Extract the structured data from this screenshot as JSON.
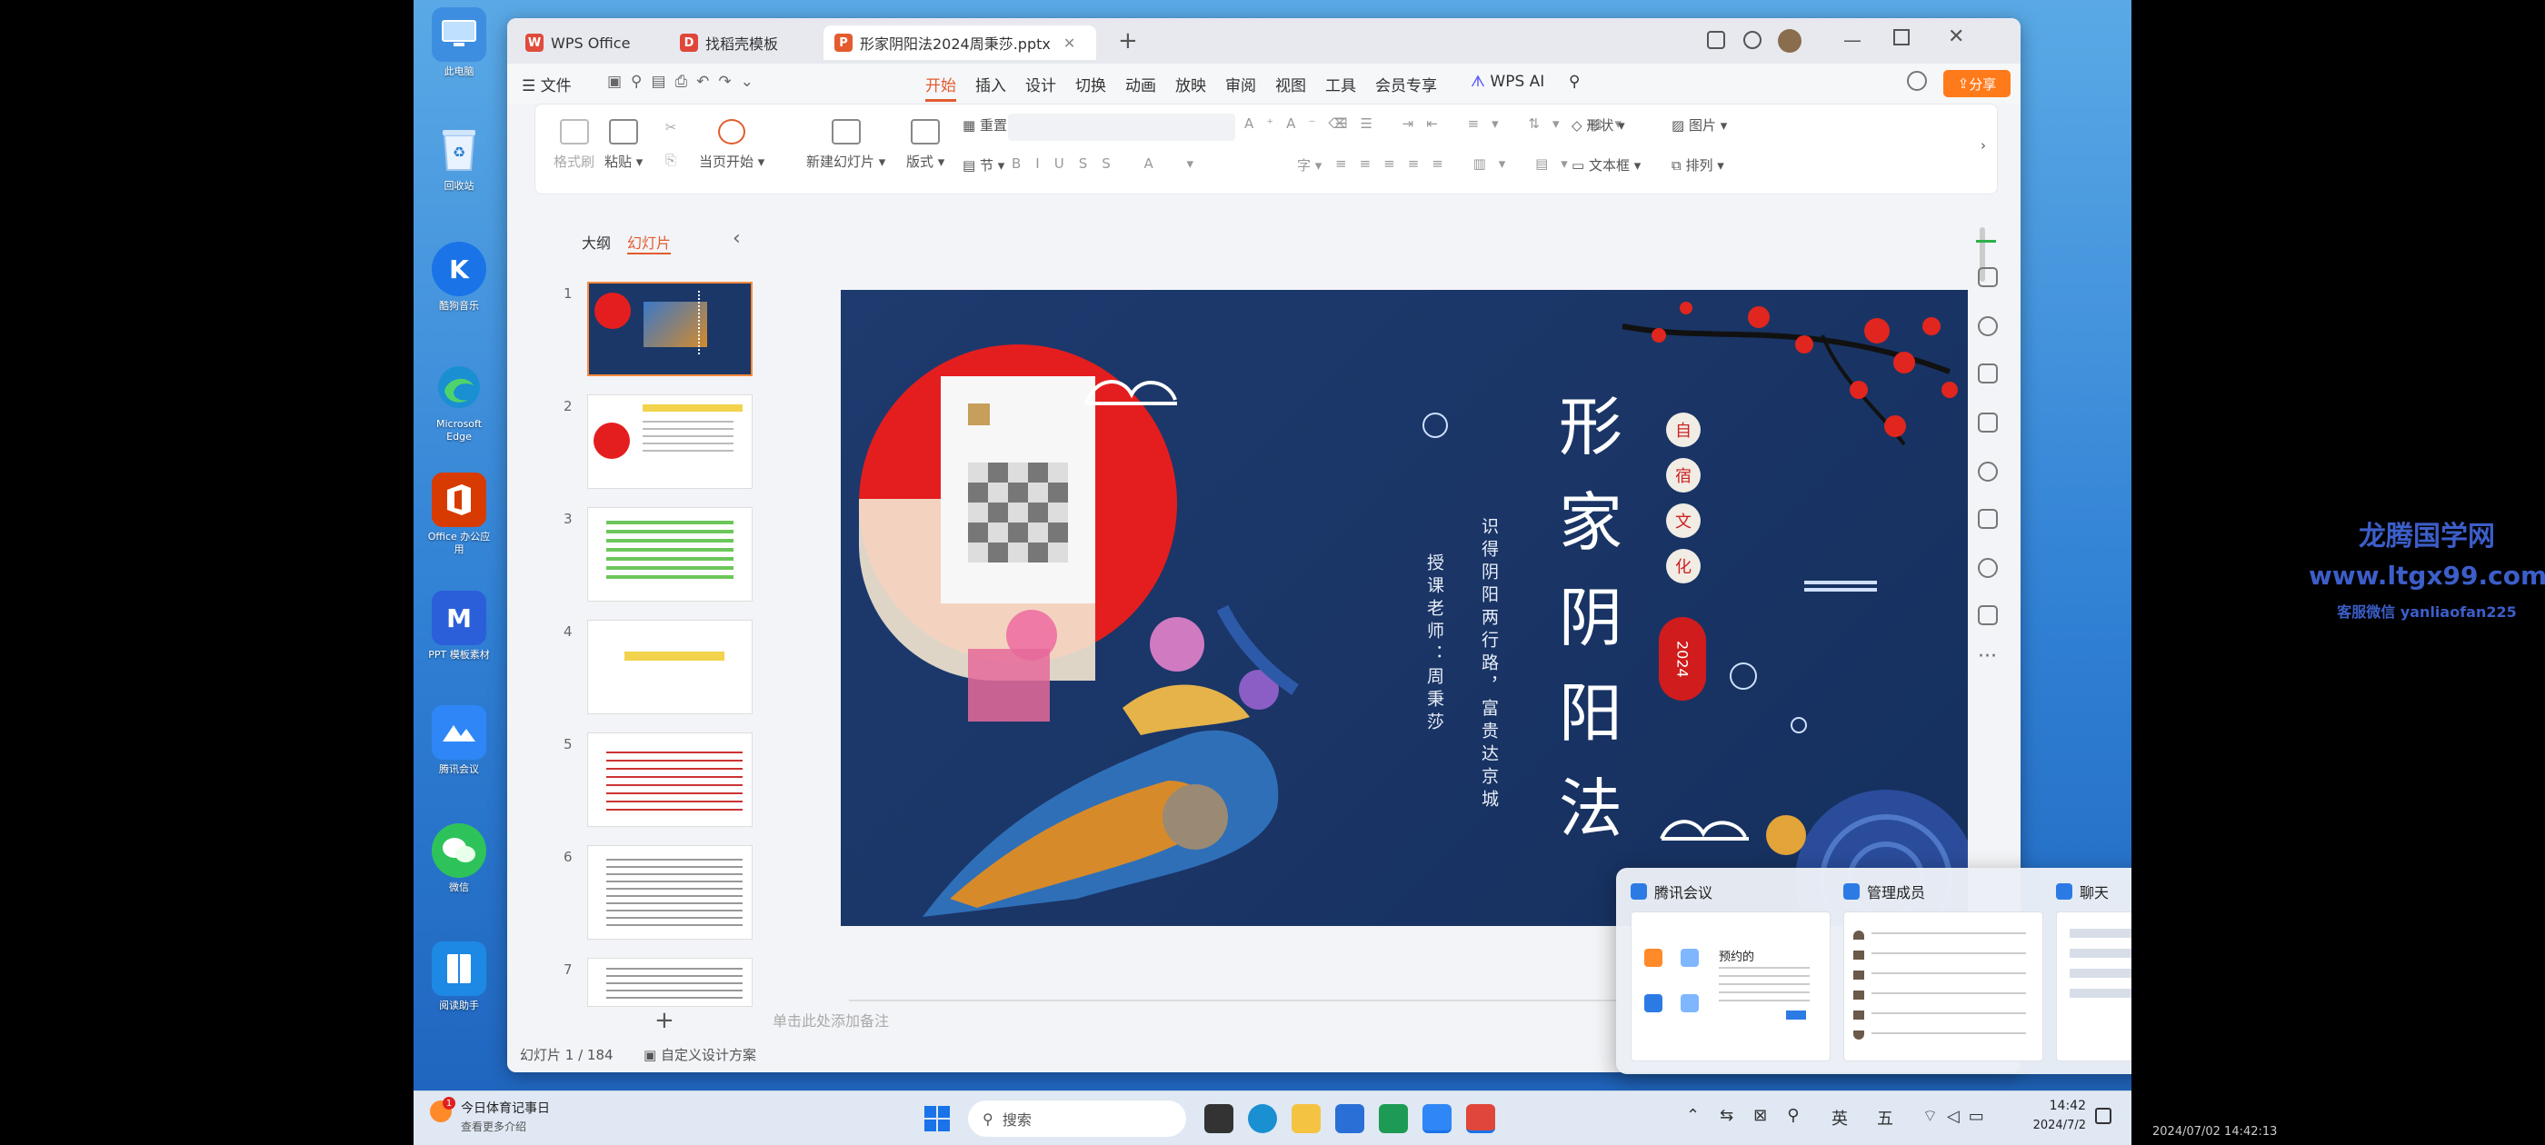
{
  "desktop": {
    "icons": [
      {
        "label": "此电脑",
        "color": "#3d8ee0",
        "glyph": ""
      },
      {
        "label": "回收站",
        "color": "#5aa0e0",
        "glyph": ""
      },
      {
        "label": "酷狗音乐",
        "color": "#1a74e8",
        "glyph": "K"
      },
      {
        "label": "Microsoft Edge",
        "color": "#1a8fd1",
        "glyph": ""
      },
      {
        "label": "Office 办公应用",
        "color": "#d83b01",
        "glyph": ""
      },
      {
        "label": "PPT 模板素材",
        "color": "#2b5fd9",
        "glyph": "M"
      },
      {
        "label": "腾讯会议",
        "color": "#2f86f6",
        "glyph": ""
      },
      {
        "label": "微信",
        "color": "#2ec35a",
        "glyph": ""
      },
      {
        "label": "阅读助手",
        "color": "#1e88e5",
        "glyph": ""
      }
    ]
  },
  "window": {
    "tabs": [
      {
        "label": "WPS Office",
        "icon_color": "#e04b3c",
        "glyph": "W"
      },
      {
        "label": "找稻壳模板",
        "icon_color": "#e0463a",
        "glyph": "D"
      },
      {
        "label": "形家阴阳法2024周秉莎.pptx",
        "icon_color": "#e35b2f",
        "glyph": "P"
      }
    ],
    "new_tab": "+",
    "share_label": "分享"
  },
  "menu": {
    "file": "文件",
    "items": [
      "开始",
      "插入",
      "设计",
      "切换",
      "动画",
      "放映",
      "审阅",
      "视图",
      "工具",
      "会员专享"
    ],
    "active": "开始",
    "ai": "WPS AI"
  },
  "ribbon": {
    "buttons": [
      {
        "label": "格式刷"
      },
      {
        "label": "粘贴"
      },
      {
        "label": "当页开始"
      },
      {
        "label": "新建幻灯片"
      },
      {
        "label": "版式"
      },
      {
        "label": "节"
      },
      {
        "label": "重置"
      },
      {
        "label": "形状"
      },
      {
        "label": "图片"
      },
      {
        "label": "文本框"
      },
      {
        "label": "排列"
      }
    ]
  },
  "leftpane": {
    "tabs": [
      "大纲",
      "幻灯片"
    ],
    "active_tab": "幻灯片",
    "slides": [
      "1",
      "2",
      "3",
      "4",
      "5",
      "6",
      "7"
    ],
    "add": "+"
  },
  "slide": {
    "title_chars": [
      "形",
      "家",
      "阴",
      "阳",
      "法"
    ],
    "badges": [
      "自",
      "宿",
      "文",
      "化"
    ],
    "year": "2024",
    "vertical_line1": "识得阴阳两行路，富贵达京城",
    "vertical_line2": "授课老师：周秉莎"
  },
  "notes_placeholder": "单击此处添加备注",
  "status": {
    "slide_counter": "幻灯片 1 / 184",
    "custom_design": "自定义设计方案"
  },
  "popup": {
    "windows": [
      {
        "title": "腾讯会议",
        "content": "预约的"
      },
      {
        "title": "管理成员",
        "content": ""
      },
      {
        "title": "聊天",
        "content": ""
      }
    ]
  },
  "taskbar": {
    "notification_title": "今日体育记事日",
    "notification_sub": "查看更多介绍",
    "search": "搜索",
    "ime1": "英",
    "ime2": "五",
    "time": "14:42",
    "date": "2024/7/2"
  },
  "watermark": {
    "line1": "龙腾国学网",
    "line2": "www.ltgx99.com",
    "line3": "客服微信 yanliaofan225"
  },
  "capture_timestamp": "2024/07/02 14:42:13",
  "colors": {
    "accent": "#ff7a1a",
    "slide_bg": "#1b3768",
    "red_sun": "#e41e1e",
    "wps_red": "#e0463a"
  }
}
